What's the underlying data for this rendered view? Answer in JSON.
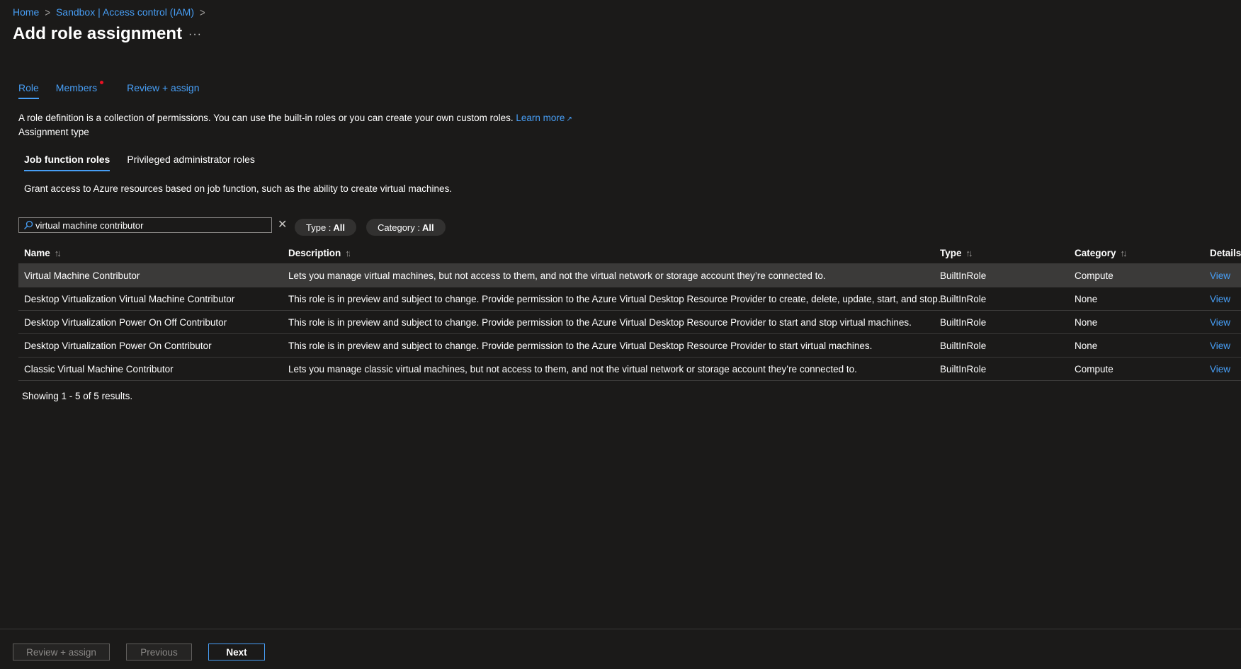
{
  "breadcrumb": {
    "home": "Home",
    "parent": "Sandbox | Access control (IAM)",
    "separator": ">"
  },
  "page": {
    "title": "Add role assignment",
    "more": "···"
  },
  "tabs": [
    {
      "label": "Role"
    },
    {
      "label": "Members"
    },
    {
      "label": "Review + assign"
    }
  ],
  "description": {
    "text": "A role definition is a collection of permissions. You can use the built-in roles or you can create your own custom roles.",
    "learn_more": "Learn more",
    "external_icon": "↗"
  },
  "assignment_type_label": "Assignment type",
  "subtabs": [
    {
      "label": "Job function roles"
    },
    {
      "label": "Privileged administrator roles"
    }
  ],
  "grant_text": "Grant access to Azure resources based on job function, such as the ability to create virtual machines.",
  "search": {
    "value": "virtual machine contributor",
    "clear": "✕"
  },
  "filters": {
    "type_label": "Type : ",
    "type_value": "All",
    "category_label": "Category : ",
    "category_value": "All"
  },
  "table": {
    "headers": {
      "name": "Name",
      "description": "Description",
      "type": "Type",
      "category": "Category",
      "details": "Details"
    },
    "sort_icon": "↑↓",
    "rows": [
      {
        "name": "Virtual Machine Contributor",
        "description": "Lets you manage virtual machines, but not access to them, and not the virtual network or storage account they’re connected to.",
        "type": "BuiltInRole",
        "category": "Compute",
        "details": "View"
      },
      {
        "name": "Desktop Virtualization Virtual Machine Contributor",
        "description": "This role is in preview and subject to change. Provide permission to the Azure Virtual Desktop Resource Provider to create, delete, update, start, and stop virt…",
        "type": "BuiltInRole",
        "category": "None",
        "details": "View"
      },
      {
        "name": "Desktop Virtualization Power On Off Contributor",
        "description": "This role is in preview and subject to change. Provide permission to the Azure Virtual Desktop Resource Provider to start and stop virtual machines.",
        "type": "BuiltInRole",
        "category": "None",
        "details": "View"
      },
      {
        "name": "Desktop Virtualization Power On Contributor",
        "description": "This role is in preview and subject to change. Provide permission to the Azure Virtual Desktop Resource Provider to start virtual machines.",
        "type": "BuiltInRole",
        "category": "None",
        "details": "View"
      },
      {
        "name": "Classic Virtual Machine Contributor",
        "description": "Lets you manage classic virtual machines, but not access to them, and not the virtual network or storage account they’re connected to.",
        "type": "BuiltInRole",
        "category": "Compute",
        "details": "View"
      }
    ]
  },
  "results_text": "Showing 1 - 5 of 5 results.",
  "footer": {
    "review_assign": "Review + assign",
    "previous": "Previous",
    "next": "Next"
  },
  "colors": {
    "background": "#1b1a19",
    "accent": "#479ef5",
    "selected_row": "#3b3a39",
    "notification_dot": "#e81123"
  }
}
